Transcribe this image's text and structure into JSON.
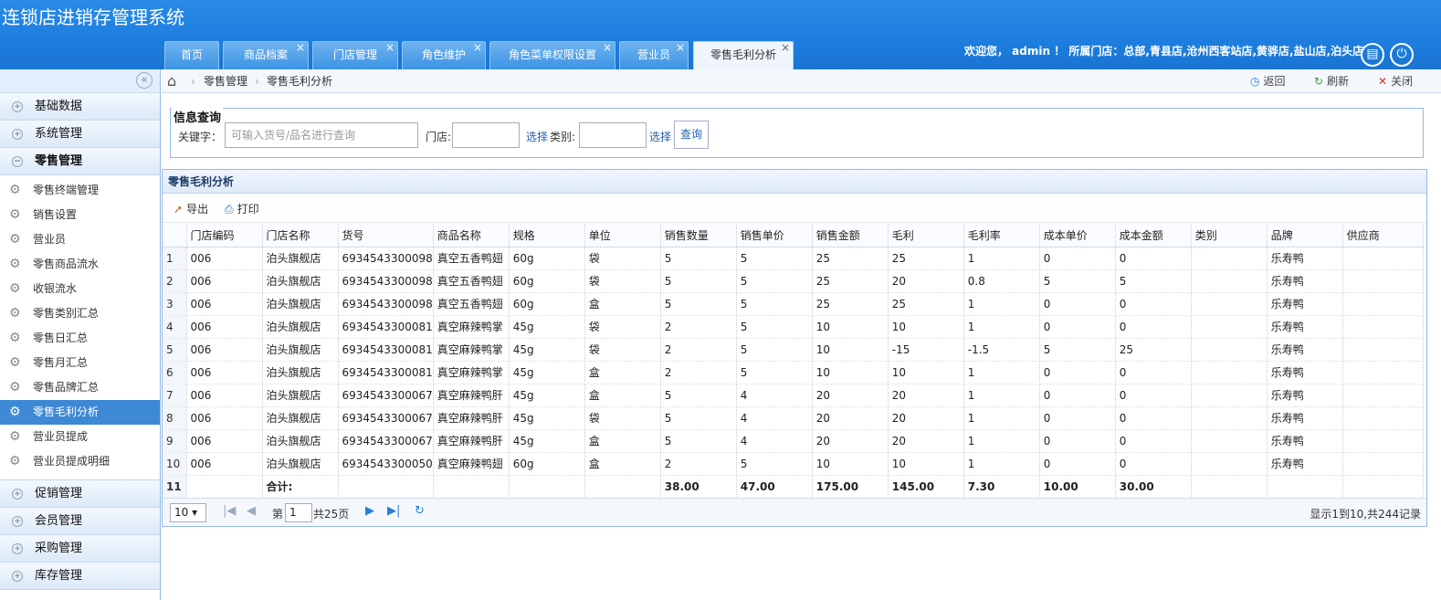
{
  "app_title": "连锁店进销存管理系统",
  "welcome": "欢迎您， admin ！ 所属门店：总部,青县店,沧州西客站店,黄骅店,盐山店,泊头店",
  "tabs": [
    "首页",
    "商品档案",
    "门店管理",
    "角色维护",
    "角色菜单权限设置",
    "营业员",
    "零售毛利分析"
  ],
  "sidebar": {
    "collapse_icon": "«",
    "groups_top": [
      "基础数据",
      "系统管理",
      "零售管理"
    ],
    "items": [
      "零售终端管理",
      "销售设置",
      "营业员",
      "零售商品流水",
      "收银流水",
      "零售类别汇总",
      "零售日汇总",
      "零售月汇总",
      "零售品牌汇总",
      "零售毛利分析",
      "营业员提成",
      "营业员提成明细"
    ],
    "active_item": "零售毛利分析",
    "groups_bottom": [
      "促销管理",
      "会员管理",
      "采购管理",
      "库存管理"
    ]
  },
  "breadcrumb": {
    "parent": "零售管理",
    "current": "零售毛利分析",
    "back": "返回",
    "refresh": "刷新",
    "close": "关闭"
  },
  "query": {
    "legend": "信息查询",
    "keyword_label": "关键字：",
    "keyword_placeholder": "可输入货号/品名进行查询",
    "store_label": "门店:",
    "select1": "选择",
    "category_label": "类别:",
    "select2": "选择",
    "search_button": "查询"
  },
  "panel": {
    "title": "零售毛利分析",
    "export": "导出",
    "print": "打印"
  },
  "table": {
    "headers": [
      "门店编码",
      "门店名称",
      "货号",
      "商品名称",
      "规格",
      "单位",
      "销售数量",
      "销售单价",
      "销售金额",
      "毛利",
      "毛利率",
      "成本单价",
      "成本金额",
      "类别",
      "品牌",
      "供应商"
    ],
    "rows": [
      [
        "1",
        "006",
        "泊头旗舰店",
        "6934543300098",
        "真空五香鸭翅",
        "60g",
        "袋",
        "5",
        "5",
        "25",
        "25",
        "1",
        "0",
        "0",
        "",
        "乐寿鸭",
        ""
      ],
      [
        "2",
        "006",
        "泊头旗舰店",
        "6934543300098",
        "真空五香鸭翅",
        "60g",
        "袋",
        "5",
        "5",
        "25",
        "20",
        "0.8",
        "5",
        "5",
        "",
        "乐寿鸭",
        ""
      ],
      [
        "3",
        "006",
        "泊头旗舰店",
        "6934543300098",
        "真空五香鸭翅",
        "60g",
        "盒",
        "5",
        "5",
        "25",
        "25",
        "1",
        "0",
        "0",
        "",
        "乐寿鸭",
        ""
      ],
      [
        "4",
        "006",
        "泊头旗舰店",
        "6934543300081",
        "真空麻辣鸭掌",
        "45g",
        "袋",
        "2",
        "5",
        "10",
        "10",
        "1",
        "0",
        "0",
        "",
        "乐寿鸭",
        ""
      ],
      [
        "5",
        "006",
        "泊头旗舰店",
        "6934543300081",
        "真空麻辣鸭掌",
        "45g",
        "袋",
        "2",
        "5",
        "10",
        "-15",
        "-1.5",
        "5",
        "25",
        "",
        "乐寿鸭",
        ""
      ],
      [
        "6",
        "006",
        "泊头旗舰店",
        "6934543300081",
        "真空麻辣鸭掌",
        "45g",
        "盒",
        "2",
        "5",
        "10",
        "10",
        "1",
        "0",
        "0",
        "",
        "乐寿鸭",
        ""
      ],
      [
        "7",
        "006",
        "泊头旗舰店",
        "6934543300067",
        "真空麻辣鸭肝",
        "45g",
        "盒",
        "5",
        "4",
        "20",
        "20",
        "1",
        "0",
        "0",
        "",
        "乐寿鸭",
        ""
      ],
      [
        "8",
        "006",
        "泊头旗舰店",
        "6934543300067",
        "真空麻辣鸭肝",
        "45g",
        "袋",
        "5",
        "4",
        "20",
        "20",
        "1",
        "0",
        "0",
        "",
        "乐寿鸭",
        ""
      ],
      [
        "9",
        "006",
        "泊头旗舰店",
        "6934543300067",
        "真空麻辣鸭肝",
        "45g",
        "盒",
        "5",
        "4",
        "20",
        "20",
        "1",
        "0",
        "0",
        "",
        "乐寿鸭",
        ""
      ],
      [
        "10",
        "006",
        "泊头旗舰店",
        "6934543300050",
        "真空麻辣鸭翅",
        "60g",
        "盒",
        "2",
        "5",
        "10",
        "10",
        "1",
        "0",
        "0",
        "",
        "乐寿鸭",
        ""
      ]
    ],
    "total_row": [
      "11",
      "",
      "合计:",
      "",
      "",
      "",
      "",
      "38.00",
      "47.00",
      "175.00",
      "145.00",
      "7.30",
      "10.00",
      "30.00",
      "",
      "",
      ""
    ]
  },
  "pager": {
    "page_size": "10 ▾",
    "page_label": "第",
    "page": "1",
    "total_pages": "共25页",
    "summary": "显示1到10,共244记录"
  },
  "icons": {
    "home": "home-icon",
    "clipboard": "clipboard-icon",
    "power": "power-icon",
    "back": "back-icon",
    "refresh": "refresh-icon",
    "close": "close-icon",
    "export": "export-icon",
    "print": "print-icon"
  }
}
